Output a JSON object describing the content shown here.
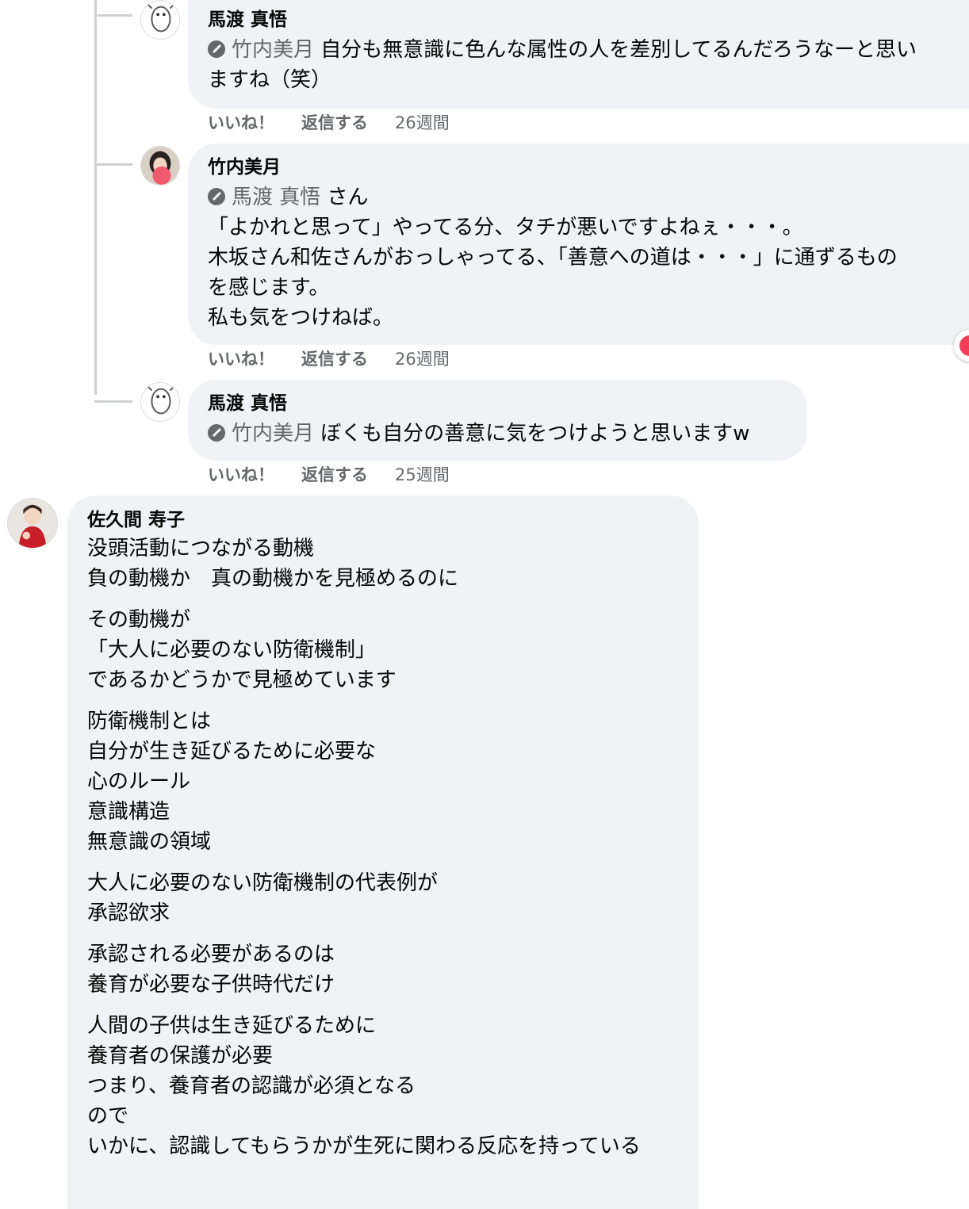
{
  "comments": [
    {
      "author": "馬渡 真悟",
      "mention": "竹内美月",
      "lines": [
        "自分も無意識に色んな属性の人を差別してるんだろうなーと思い",
        "ますね（笑）"
      ],
      "actions": {
        "like": "いいね！",
        "reply": "返信する",
        "time": "26週間"
      }
    },
    {
      "author": "竹内美月",
      "mention": "馬渡 真悟",
      "mention_suffix": "さん",
      "lines": [
        "「よかれと思って」やってる分、タチが悪いですよねぇ・・・。",
        "木坂さん和佐さんがおっしゃってる、「善意への道は・・・」に通ずるもの",
        "を感じます。",
        "私も気をつけねば。"
      ],
      "actions": {
        "like": "いいね！",
        "reply": "返信する",
        "time": "26週間"
      }
    },
    {
      "author": "馬渡 真悟",
      "mention": "竹内美月",
      "lines": [
        "ぼくも自分の善意に気をつけようと思いますw"
      ],
      "actions": {
        "like": "いいね！",
        "reply": "返信する",
        "time": "25週間"
      }
    },
    {
      "author": "佐久間 寿子",
      "paragraphs": [
        [
          "没頭活動につながる動機",
          "負の動機か　真の動機かを見極めるのに"
        ],
        [
          "その動機が",
          "「大人に必要のない防衛機制」",
          "であるかどうかで見極めています"
        ],
        [
          "防衛機制とは",
          "自分が生き延びるために必要な",
          "心のルール",
          "意識構造",
          "無意識の領域"
        ],
        [
          "大人に必要のない防衛機制の代表例が",
          "承認欲求"
        ],
        [
          "承認される必要があるのは",
          "養育が必要な子供時代だけ"
        ],
        [
          "人間の子供は生き延びるために",
          "養育者の保護が必要",
          "つまり、養育者の認識が必須となる",
          "ので",
          "いかに、認識してもらうかが生死に関わる反応を持っている"
        ]
      ]
    }
  ],
  "colors": {
    "bubble": "#f0f2f5",
    "meta": "#65676b",
    "text": "#050505",
    "reaction": "#f33e58"
  },
  "icons": [
    "avatar-mawatari",
    "avatar-takeuchi",
    "avatar-sakuma",
    "mention-icon",
    "love-reaction-icon"
  ]
}
